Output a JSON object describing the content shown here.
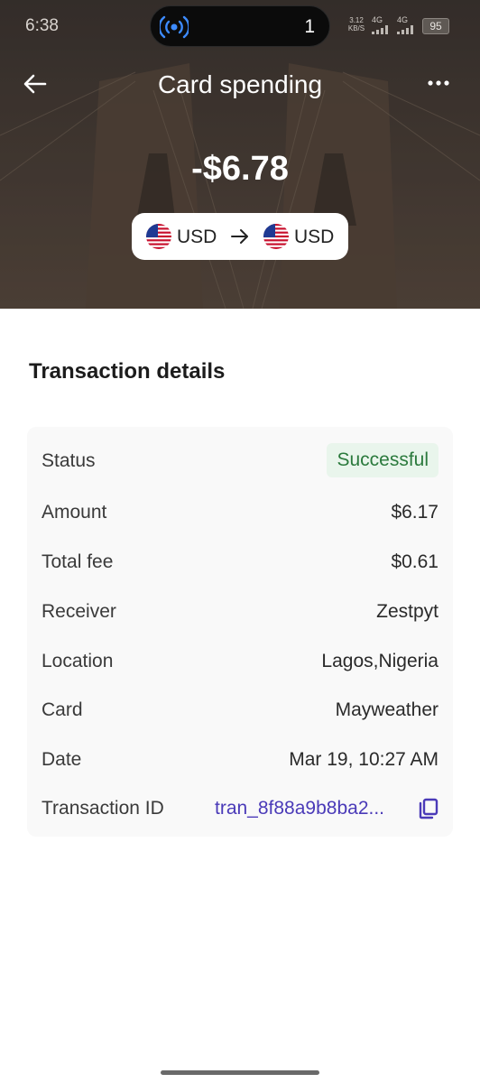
{
  "status_bar": {
    "time": "6:38",
    "live_count": "1",
    "net_speed_value": "3.12",
    "net_speed_unit": "KB/S",
    "signal1": "4G",
    "signal2": "4G",
    "battery": "95"
  },
  "header": {
    "title": "Card spending",
    "amount": "-$6.78",
    "from_currency": "USD",
    "to_currency": "USD"
  },
  "details": {
    "section_title": "Transaction details",
    "rows": [
      {
        "label": "Status",
        "value": "Successful"
      },
      {
        "label": "Amount",
        "value": "$6.17"
      },
      {
        "label": "Total fee",
        "value": "$0.61"
      },
      {
        "label": "Receiver",
        "value": "Zestpyt"
      },
      {
        "label": "Location",
        "value": "Lagos,Nigeria"
      },
      {
        "label": "Card",
        "value": "Mayweather"
      },
      {
        "label": "Date",
        "value": "Mar 19, 10:27 AM"
      },
      {
        "label": "Transaction ID",
        "value": "tran_8f88a9b8ba2..."
      }
    ]
  },
  "colors": {
    "accent_link": "#4a3ab8",
    "success_text": "#2b7a3d",
    "success_bg": "#e9f5ec"
  },
  "icons": {
    "back": "arrow-left-icon",
    "more": "more-dots-icon",
    "flag": "us-flag-icon",
    "convert": "arrow-right-icon",
    "copy": "copy-icon",
    "live": "broadcast-icon"
  }
}
